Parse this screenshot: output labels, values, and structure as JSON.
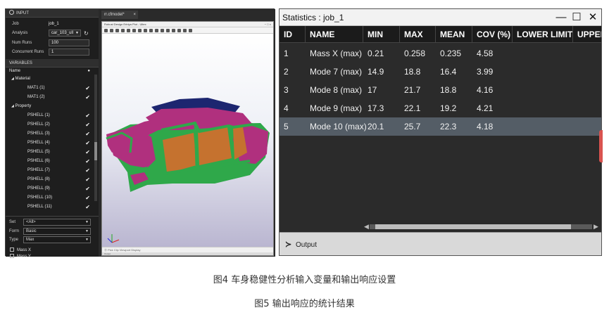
{
  "left_app": {
    "input_section": {
      "header": "INPUT",
      "fields": [
        {
          "label": "Job",
          "value": "job_1"
        },
        {
          "label": "Analysis",
          "value": "car_103_ull"
        },
        {
          "label": "Num Runs",
          "value": "100"
        },
        {
          "label": "Concurrent Runs",
          "value": "1"
        }
      ]
    },
    "variables_section": {
      "header": "VARIABLES",
      "column_name": "Name",
      "groups": [
        {
          "label": "Material",
          "items": [
            "MAT1 (1)",
            "MAT1 (2)"
          ]
        },
        {
          "label": "Property",
          "items": [
            "PSHELL (1)",
            "PSHELL (2)",
            "PSHELL (3)",
            "PSHELL (4)",
            "PSHELL (5)",
            "PSHELL (6)",
            "PSHELL (7)",
            "PSHELL (8)",
            "PSHELL (9)",
            "PSHELL (10)",
            "PSHELL (11)"
          ]
        }
      ]
    },
    "filters": [
      {
        "label": "Set",
        "value": "<All>"
      },
      {
        "label": "Form",
        "value": "Basic"
      },
      {
        "label": "Type",
        "value": "Max"
      }
    ],
    "responses": [
      "Mass X",
      "Mass Y"
    ],
    "document_tab": "rr.cfmodel*",
    "viewer": {
      "title": "Robust Design Ertriya Plot - Ultex",
      "status": "Pick  Clip  Viewport  Display",
      "output_label": "Output"
    }
  },
  "stats_window": {
    "title": "Statistics : job_1",
    "columns": [
      "ID",
      "NAME",
      "MIN",
      "MAX",
      "MEAN",
      "COV (%)",
      "LOWER LIMIT",
      "UPPER"
    ],
    "rows": [
      {
        "id": "1",
        "name": "Mass X (max)",
        "min": "0.21",
        "max": "0.258",
        "mean": "0.235",
        "cov": "4.58"
      },
      {
        "id": "2",
        "name": "Mode 7 (max)",
        "min": "14.9",
        "max": "18.8",
        "mean": "16.4",
        "cov": "3.99"
      },
      {
        "id": "3",
        "name": "Mode 8 (max)",
        "min": "17",
        "max": "21.7",
        "mean": "18.8",
        "cov": "4.16"
      },
      {
        "id": "4",
        "name": "Mode 9 (max)",
        "min": "17.3",
        "max": "22.1",
        "mean": "19.2",
        "cov": "4.21"
      },
      {
        "id": "5",
        "name": "Mode 10 (max)",
        "min": "20.1",
        "max": "25.7",
        "mean": "22.3",
        "cov": "4.18"
      }
    ],
    "selected_row": 5,
    "output_label": "Output"
  },
  "captions": {
    "fig4": "图4 车身稳健性分析输入变量和输出响应设置",
    "fig5": "图5 输出响应的统计结果"
  },
  "colors": {
    "app_bg": "#1e1e1e",
    "selected_row": "#545d66",
    "car_body": "#b0307e",
    "car_panels": "#c5722f",
    "car_frame": "#2fa84a",
    "car_roof": "#1d2670"
  }
}
